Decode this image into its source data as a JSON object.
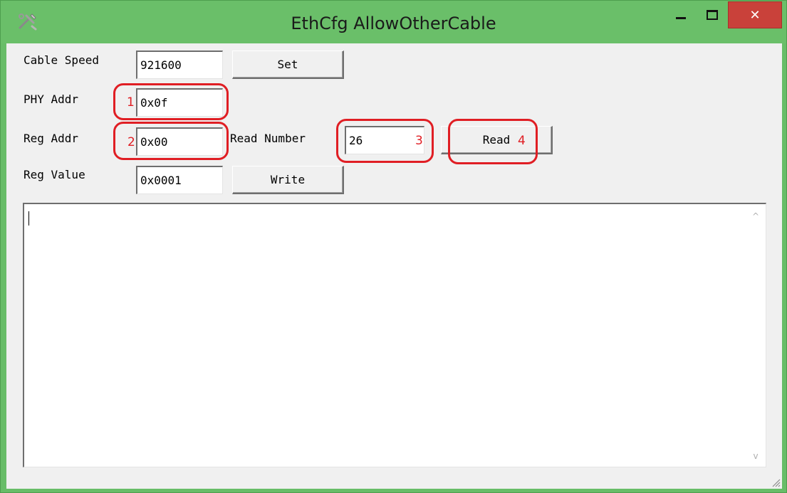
{
  "window": {
    "title": "EthCfg AllowOtherCable",
    "close_glyph": "✕"
  },
  "form": {
    "cable_speed_label": "Cable Speed",
    "cable_speed_value": "921600",
    "set_label": "Set",
    "phy_addr_label": "PHY Addr",
    "phy_addr_value": "0x0f",
    "reg_addr_label": "Reg Addr",
    "reg_addr_value": "0x00",
    "read_number_label": "Read Number",
    "read_number_value": "26",
    "read_label": "Read",
    "reg_value_label": "Reg Value",
    "reg_value_value": "0x0001",
    "write_label": "Write"
  },
  "annotations": {
    "n1": "1",
    "n2": "2",
    "n3": "3",
    "n4": "4",
    "color": "#e01e24"
  },
  "output": {
    "text": "",
    "scroll_up_glyph": "^",
    "scroll_down_glyph": "v"
  },
  "icons": {
    "app": "tools-icon",
    "minimize": "minimize-icon",
    "maximize": "maximize-icon",
    "close": "close-icon",
    "resize": "resize-grip-icon"
  },
  "colors": {
    "titlebar": "#6abf69",
    "close_button": "#c9413a",
    "client": "#f0f0f0"
  }
}
